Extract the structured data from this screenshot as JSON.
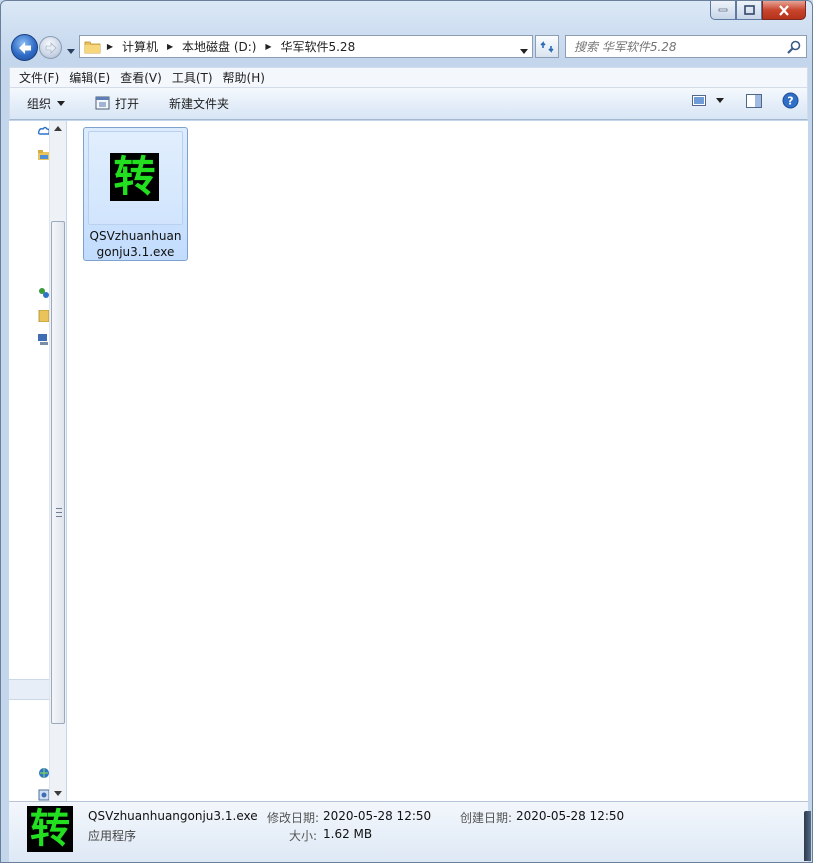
{
  "window": {
    "caption_buttons": [
      "minimize",
      "maximize",
      "close"
    ]
  },
  "address": {
    "breadcrumbs": [
      "计算机",
      "本地磁盘 (D:)",
      "华军软件5.28"
    ]
  },
  "search": {
    "placeholder": "搜索 华军软件5.28"
  },
  "menu": {
    "items": [
      "文件(F)",
      "编辑(E)",
      "查看(V)",
      "工具(T)",
      "帮助(H)"
    ]
  },
  "toolbar": {
    "organize_label": "组织",
    "open_label": "打开",
    "new_folder_label": "新建文件夹"
  },
  "files": [
    {
      "name": "QSVzhuanhuangonju3.1.exe",
      "icon_glyph": "转",
      "selected": true
    }
  ],
  "details": {
    "icon_glyph": "转",
    "file_name": "QSVzhuanhuangonju3.1.exe",
    "file_type": "应用程序",
    "modified_label": "修改日期:",
    "modified_value": "2020-05-28 12:50",
    "created_label": "创建日期:",
    "created_value": "2020-05-28 12:50",
    "size_label": "大小:",
    "size_value": "1.62 MB"
  },
  "colors": {
    "icon_green": "#22e020",
    "icon_bg": "#000000",
    "selection": "#cce0fc",
    "close_red": "#c9452d"
  }
}
